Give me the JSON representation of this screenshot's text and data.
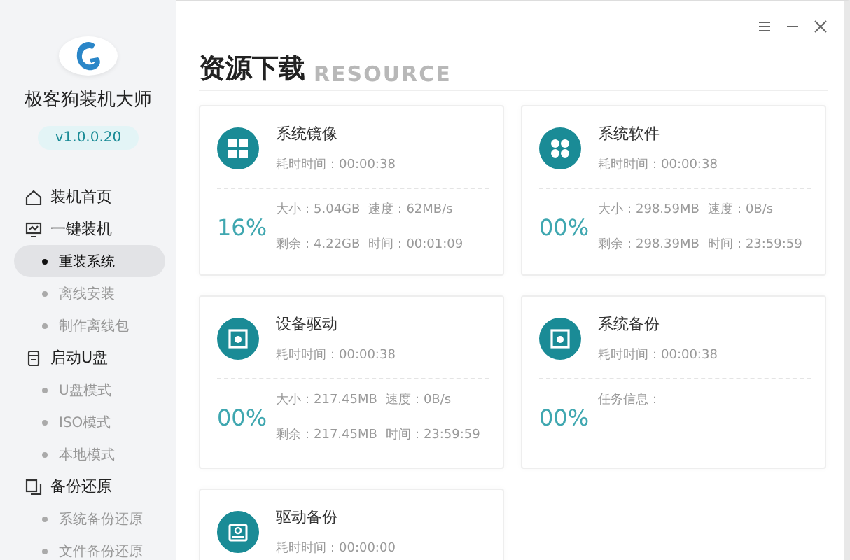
{
  "app": {
    "name": "极客狗装机大师",
    "version": "v1.0.0.20"
  },
  "sidebar": {
    "sections": [
      {
        "label": "装机首页"
      },
      {
        "label": "一键装机",
        "children": [
          {
            "label": "重装系统",
            "selected": true
          },
          {
            "label": "离线安装",
            "selected": false
          },
          {
            "label": "制作离线包",
            "selected": false
          }
        ]
      },
      {
        "label": "启动U盘",
        "children": [
          {
            "label": "U盘模式",
            "selected": false
          },
          {
            "label": "ISO模式",
            "selected": false
          },
          {
            "label": "本地模式",
            "selected": false
          }
        ]
      },
      {
        "label": "备份还原",
        "children": [
          {
            "label": "系统备份还原",
            "selected": false
          },
          {
            "label": "文件备份还原",
            "selected": false
          }
        ]
      }
    ]
  },
  "page": {
    "title": "资源下载",
    "backdrop_text": "RESOURCE"
  },
  "cards": [
    {
      "kind": "transfer",
      "title": "系统镜像",
      "elapsed": "耗时时间：00:00:38",
      "percent": "16%",
      "size": "大小：5.04GB",
      "speed": "速度：62MB/s",
      "remaining": "剩余：4.22GB",
      "time": "时间：00:01:09"
    },
    {
      "kind": "transfer",
      "title": "系统软件",
      "elapsed": "耗时时间：00:00:38",
      "percent": "00%",
      "size": "大小：298.59MB",
      "speed": "速度：0B/s",
      "remaining": "剩余：298.39MB",
      "time": "时间：23:59:59"
    },
    {
      "kind": "transfer",
      "title": "设备驱动",
      "elapsed": "耗时时间：00:00:38",
      "percent": "00%",
      "size": "大小：217.45MB",
      "speed": "速度：0B/s",
      "remaining": "剩余：217.45MB",
      "time": "时间：23:59:59"
    },
    {
      "kind": "task",
      "title": "系统备份",
      "elapsed": "耗时时间：00:00:38",
      "percent": "00%",
      "info": "任务信息："
    },
    {
      "kind": "header",
      "title": "驱动备份",
      "elapsed": "耗时时间：00:00:00"
    }
  ]
}
